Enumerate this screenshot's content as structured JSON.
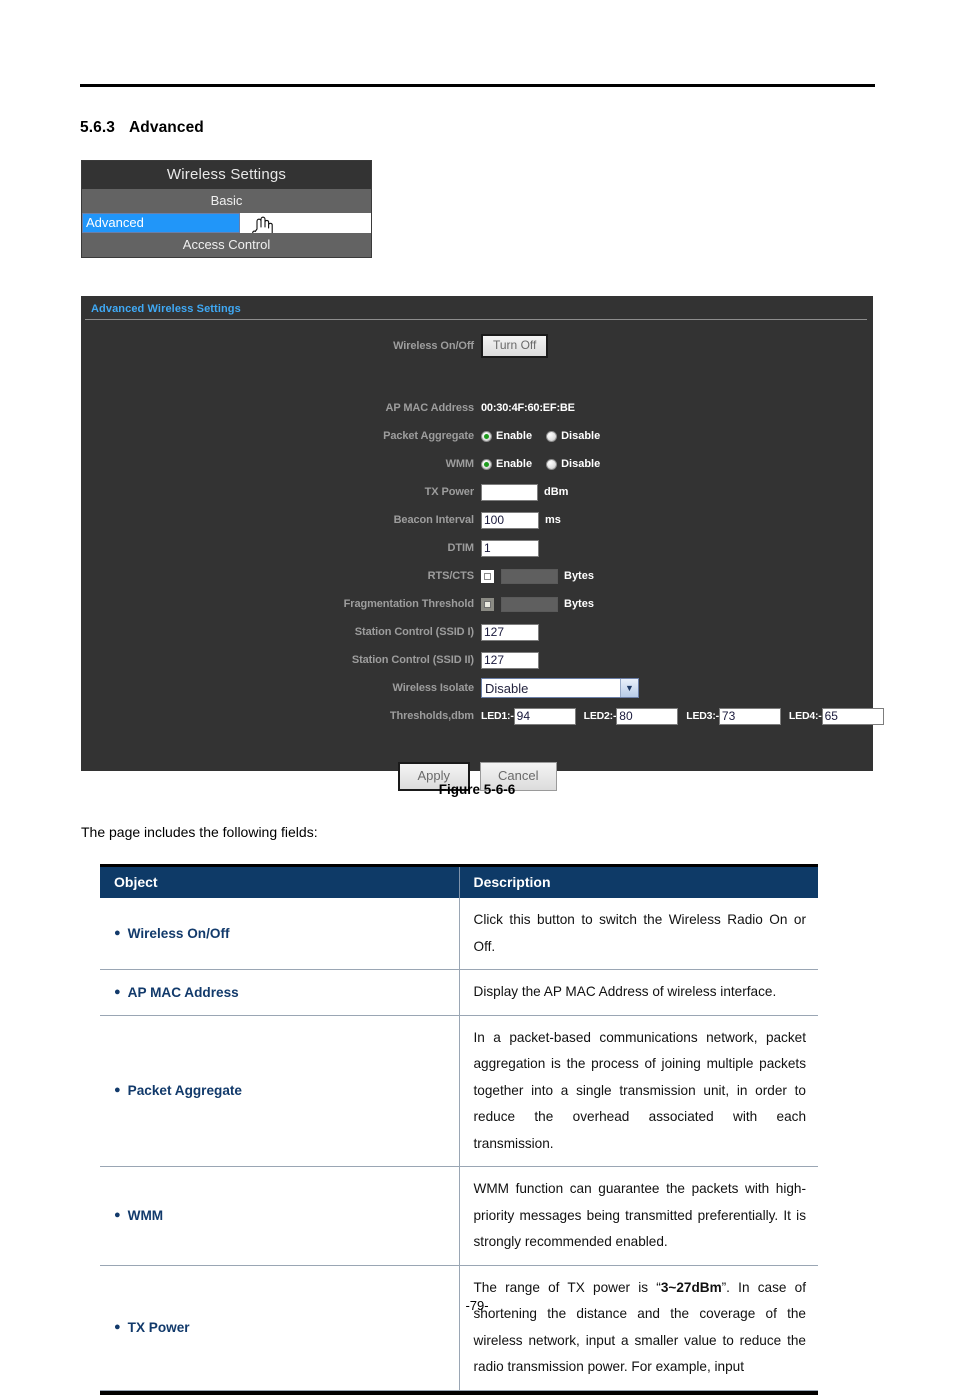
{
  "heading": {
    "number": "5.6.3",
    "title": "Advanced"
  },
  "menu": {
    "title": "Wireless Settings",
    "items": [
      {
        "label": "Basic",
        "selected": false
      },
      {
        "label": "Advanced",
        "selected": true
      },
      {
        "label": "Access Control",
        "selected": false
      }
    ]
  },
  "panel": {
    "header": "Advanced Wireless Settings",
    "fields": {
      "wireless_onoff_label": "Wireless On/Off",
      "wireless_onoff_button": "Turn Off",
      "ap_mac_label": "AP MAC Address",
      "ap_mac_value": "00:30:4F:60:EF:BE",
      "packet_aggregate_label": "Packet Aggregate",
      "wmm_label": "WMM",
      "radio_enable": "Enable",
      "radio_disable": "Disable",
      "tx_power_label": "TX Power",
      "tx_power_value": "",
      "tx_power_unit": "dBm",
      "beacon_interval_label": "Beacon Interval",
      "beacon_interval_value": "100",
      "beacon_interval_unit": "ms",
      "dtim_label": "DTIM",
      "dtim_value": "1",
      "rts_cts_label": "RTS/CTS",
      "rts_cts_value": "",
      "rts_cts_unit": "Bytes",
      "frag_threshold_label": "Fragmentation Threshold",
      "frag_threshold_value": "",
      "frag_threshold_unit": "Bytes",
      "station_ctrl_1_label": "Station Control (SSID I)",
      "station_ctrl_1_value": "127",
      "station_ctrl_2_label": "Station Control (SSID II)",
      "station_ctrl_2_value": "127",
      "wireless_isolate_label": "Wireless Isolate",
      "wireless_isolate_value": "Disable",
      "thresholds_label": "Thresholds,dbm",
      "thresholds": [
        {
          "name": "LED1:-",
          "value": "94"
        },
        {
          "name": "LED2:-",
          "value": "80"
        },
        {
          "name": "LED3:-",
          "value": "73"
        },
        {
          "name": "LED4:-",
          "value": "65"
        }
      ],
      "apply_label": "Apply",
      "cancel_label": "Cancel"
    }
  },
  "figure_caption": "Figure 5-6-6",
  "intro_text": "The page includes the following fields:",
  "table": {
    "headers": {
      "object": "Object",
      "description": "Description"
    },
    "rows": [
      {
        "object": "Wireless On/Off",
        "description": "Click this button to switch the Wireless Radio On or Off."
      },
      {
        "object": "AP MAC Address",
        "description": "Display the AP MAC Address of wireless interface."
      },
      {
        "object": "Packet Aggregate",
        "description": "In a packet-based communications network, packet aggregation is the process of joining multiple packets together into a single transmission unit, in order to reduce the overhead associated with each transmission."
      },
      {
        "object": "WMM",
        "description": "WMM function can guarantee the packets with high-priority messages being transmitted preferentially. It is strongly recommended enabled."
      },
      {
        "object": "TX Power",
        "description_pre": "The range of TX power is “",
        "description_bold": "3~27dBm",
        "description_post": "”. In case of shortening the distance and the coverage of the wireless network, input a smaller value to reduce the radio transmission power. For example, input"
      }
    ]
  },
  "footer": "-79-",
  "colors": {
    "panel_bg": "#333333",
    "panel_header_text": "#3fa9f5",
    "menu_selected": "#2196f9",
    "table_header_bg": "#0e3a67",
    "object_text": "#123a6b",
    "radio_on": "#1d9b1d"
  }
}
